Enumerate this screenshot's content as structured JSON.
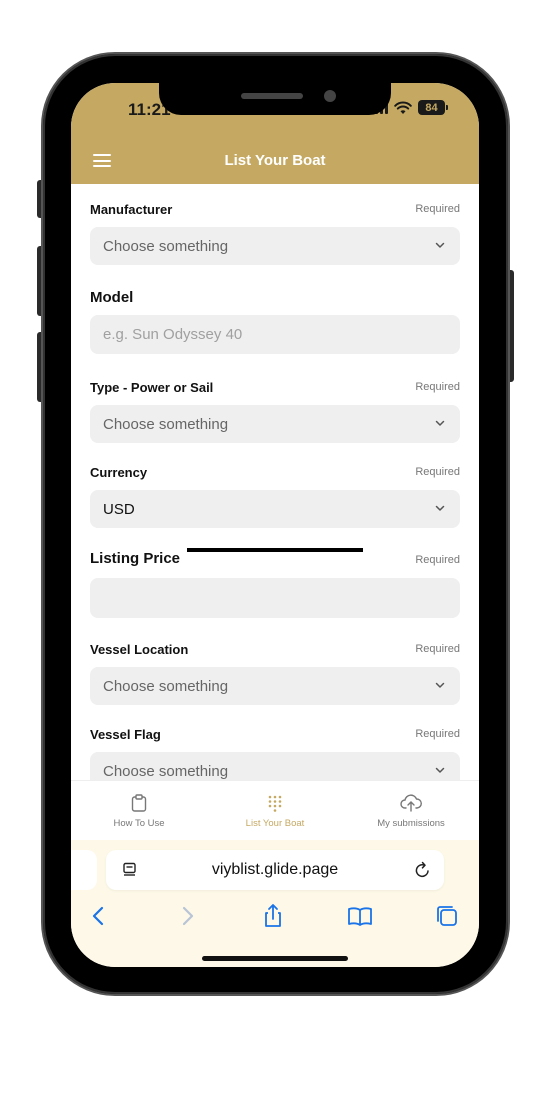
{
  "status": {
    "time": "11:21",
    "battery": "84"
  },
  "header": {
    "title": "List Your Boat"
  },
  "form": {
    "required_text": "Required",
    "manufacturer": {
      "label": "Manufacturer",
      "value": "Choose something"
    },
    "model": {
      "label": "Model",
      "placeholder": "e.g. Sun Odyssey 40"
    },
    "type": {
      "label": "Type - Power or Sail",
      "value": "Choose something"
    },
    "currency": {
      "label": "Currency",
      "value": "USD"
    },
    "listing_price": {
      "label": "Listing Price",
      "value": ""
    },
    "vessel_location": {
      "label": "Vessel Location",
      "value": "Choose something"
    },
    "vessel_flag": {
      "label": "Vessel Flag",
      "value": "Choose something"
    }
  },
  "bottom_nav": {
    "items": [
      {
        "label": "How To Use",
        "icon": "clipboard-icon"
      },
      {
        "label": "List Your Boat",
        "icon": "dot-grid-icon",
        "active": true
      },
      {
        "label": "My submissions",
        "icon": "cloud-upload-icon"
      }
    ]
  },
  "browser": {
    "url": "viyblist.glide.page"
  },
  "colors": {
    "accent": "#c5a963",
    "field_bg": "#efefef",
    "browser_bg": "#fdf8e7",
    "ios_blue": "#1a73e8"
  }
}
